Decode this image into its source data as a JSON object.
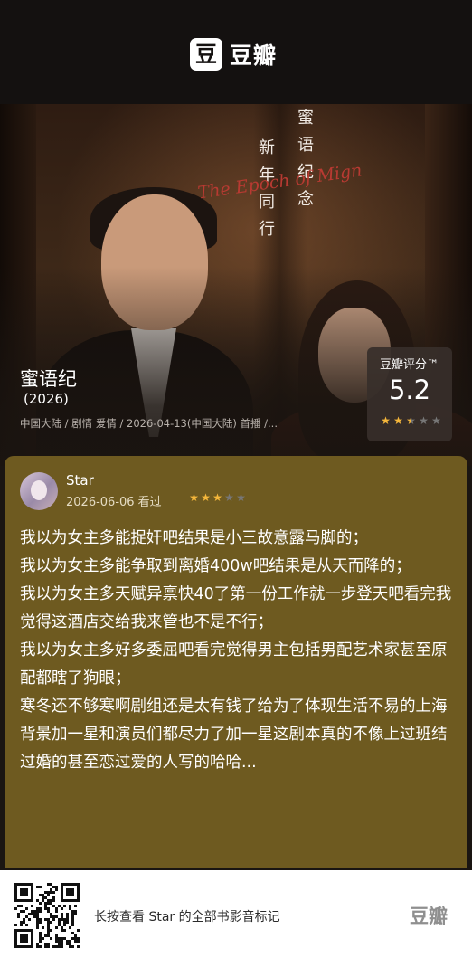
{
  "header": {
    "logo_icon": "豆",
    "logo_text": "豆瓣"
  },
  "poster": {
    "vertical_main": "新年同行",
    "vertical_sub": "蜜语纪念",
    "script_title": "The Epoch of Mign"
  },
  "movie": {
    "title": "蜜语纪",
    "year": "(2026)",
    "meta": "中国大陆 / 剧情 爱情 / 2026-04-13(中国大陆) 首播 /..."
  },
  "rating": {
    "label": "豆瓣评分™",
    "score": "5.2",
    "stars_filled": 2.5,
    "star_color": "#f5b73b",
    "star_empty_color": "#777777"
  },
  "review": {
    "username": "Star",
    "date": "2026-06-06 看过",
    "stars_filled": 3,
    "star_color": "#f5b73b",
    "paragraphs": [
      "我以为女主多能捉奸吧结果是小三故意露马脚的；",
      "我以为女主多能争取到离婚400w吧结果是从天而降的；",
      "我以为女主多天赋异禀快40了第一份工作就一步登天吧看完我觉得这酒店交给我来管也不是不行；",
      "我以为女主多好多委屈吧看完觉得男主包括男配艺术家甚至原配都瞎了狗眼；",
      "寒冬还不够寒啊剧组还是太有钱了给为了体现生活不易的上海背景加一星和演员们都尽力了加一星这剧本真的不像上过班结过婚的甚至恋过爱的人写的哈哈..."
    ]
  },
  "footer": {
    "text": "长按查看 Star 的全部书影音标记",
    "logo": "豆瓣"
  }
}
